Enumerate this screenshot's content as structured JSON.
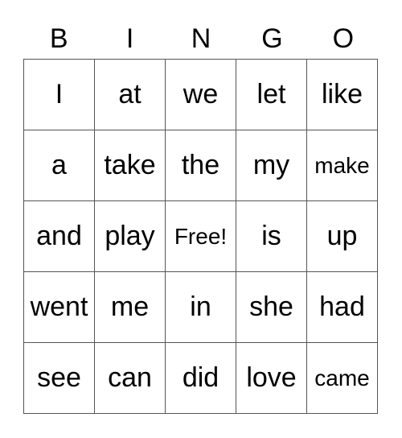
{
  "header": [
    "B",
    "I",
    "N",
    "G",
    "O"
  ],
  "rows": [
    [
      "I",
      "at",
      "we",
      "let",
      "like"
    ],
    [
      "a",
      "take",
      "the",
      "my",
      "make"
    ],
    [
      "and",
      "play",
      "Free!",
      "is",
      "up"
    ],
    [
      "went",
      "me",
      "in",
      "she",
      "had"
    ],
    [
      "see",
      "can",
      "did",
      "love",
      "came"
    ]
  ],
  "free_space": "Free!"
}
